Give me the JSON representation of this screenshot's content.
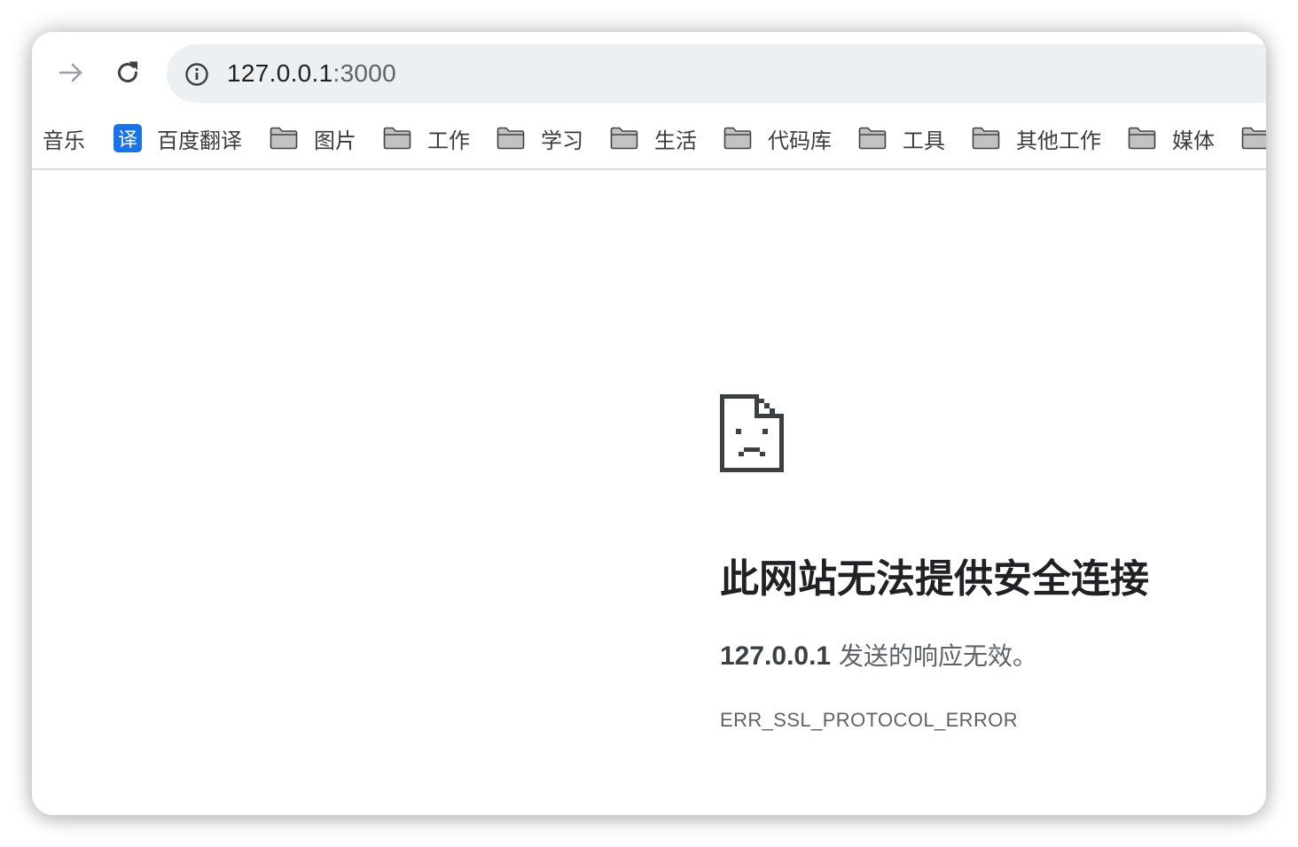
{
  "toolbar": {
    "forward_icon": "arrow-right-icon",
    "reload_icon": "reload-icon",
    "site_info_icon": "info-icon",
    "url_host": "127.0.0.1",
    "url_port": ":3000"
  },
  "bookmarks": [
    {
      "label": "音乐",
      "icon": "none"
    },
    {
      "label": "百度翻译",
      "icon": "translate-icon",
      "icon_text": "译"
    },
    {
      "label": "图片",
      "icon": "folder-icon"
    },
    {
      "label": "工作",
      "icon": "folder-icon"
    },
    {
      "label": "学习",
      "icon": "folder-icon"
    },
    {
      "label": "生活",
      "icon": "folder-icon"
    },
    {
      "label": "代码库",
      "icon": "folder-icon"
    },
    {
      "label": "工具",
      "icon": "folder-icon"
    },
    {
      "label": "其他工作",
      "icon": "folder-icon"
    },
    {
      "label": "媒体",
      "icon": "folder-icon"
    }
  ],
  "error": {
    "icon": "sad-page-icon",
    "title": "此网站无法提供安全连接",
    "host": "127.0.0.1",
    "message": " 发送的响应无效。",
    "code": "ERR_SSL_PROTOCOL_ERROR"
  },
  "colors": {
    "omnibox_bg": "#edf0f2",
    "translate_badge": "#1a73e8",
    "title": "#202124",
    "secondary_text": "#5f6368"
  }
}
